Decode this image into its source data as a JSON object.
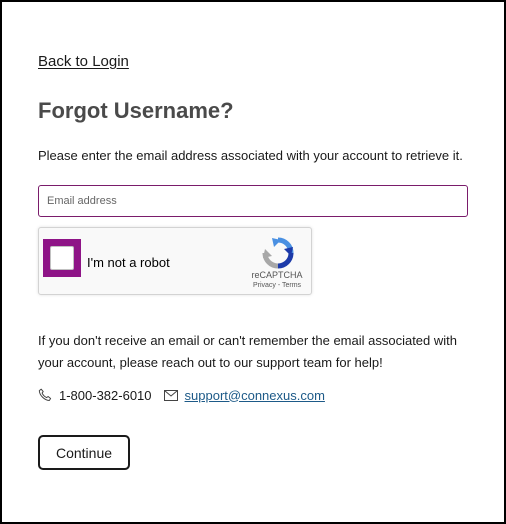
{
  "nav": {
    "back_label": "Back to Login"
  },
  "page": {
    "title": "Forgot Username?",
    "instructions": "Please enter the email address associated with your account to retrieve it."
  },
  "form": {
    "email_value": "",
    "email_placeholder": "Email address",
    "continue_label": "Continue"
  },
  "recaptcha": {
    "label": "I'm not a robot",
    "brand": "reCAPTCHA",
    "privacy": "Privacy",
    "separator": " - ",
    "terms": "Terms",
    "checked": false
  },
  "support": {
    "text": "If you don't receive an email or can't remember the email associated with your account, please reach out to our support team for help!",
    "phone": "1-800-382-6010",
    "email": "support@connexus.com"
  },
  "icons": {
    "phone": "phone-icon",
    "email": "envelope-icon",
    "recaptcha": "recaptcha-logo-icon"
  },
  "colors": {
    "focus_border": "#7a1c6b",
    "checkbox_highlight": "#8e1487",
    "link": "#1d5a88",
    "title": "#4a4a4a"
  }
}
